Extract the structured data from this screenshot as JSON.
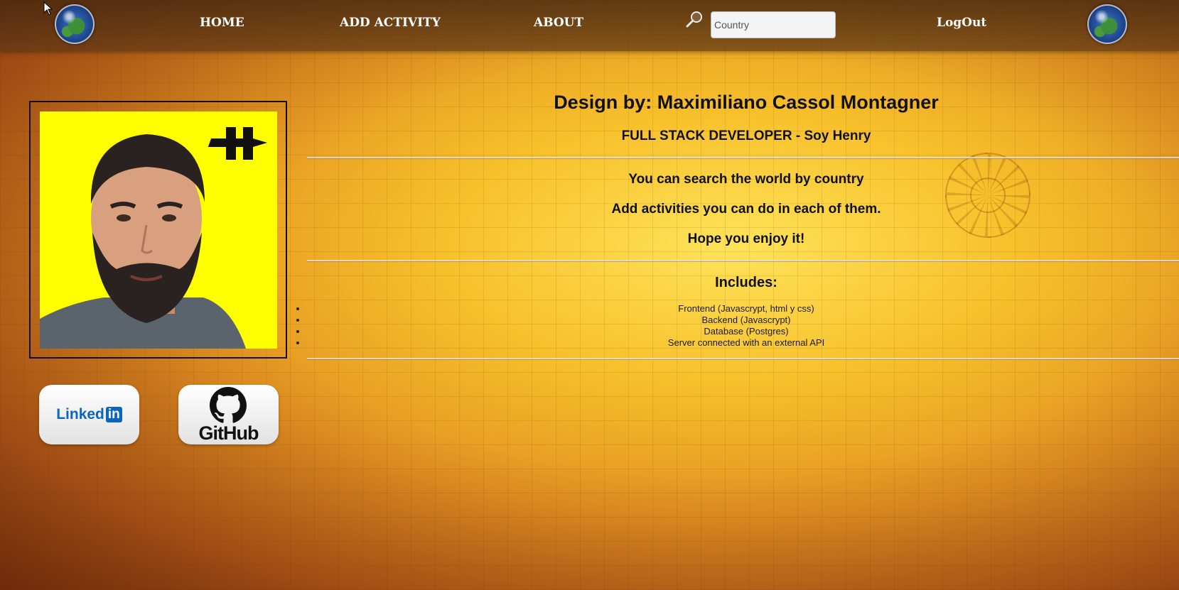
{
  "navbar": {
    "links": [
      {
        "label": "HOME"
      },
      {
        "label": "ADD ACTIVITY"
      },
      {
        "label": "ABOUT"
      },
      {
        "label": "LogOut"
      }
    ],
    "search": {
      "placeholder": "Country",
      "value": ""
    },
    "icons": [
      "globe-icon",
      "search-icon",
      "globe-icon",
      "cursor-icon"
    ]
  },
  "main": {
    "title": "Design by: Maximiliano Cassol Montagner",
    "subtitle": "FULL STACK DEVELOPER - Soy Henry",
    "description": [
      "You can search the world by country",
      "Add activities you can do in each of them.",
      "Hope you enjoy it!"
    ],
    "includes_title": "Includes:",
    "includes": [
      "Frontend (Javascrypt, html y css)",
      "Backend (Javascrypt)",
      "Database (Postgres)",
      "Server connected with an external API"
    ]
  },
  "social": {
    "linkedin": {
      "label": "Linked",
      "badge": "in"
    },
    "github": {
      "label": "GitHub"
    }
  },
  "colors": {
    "navbar": "#5a3414",
    "profile_bg": "#ffff00",
    "linkedin_blue": "#0a66c2",
    "nav_text": "#ffffff"
  }
}
